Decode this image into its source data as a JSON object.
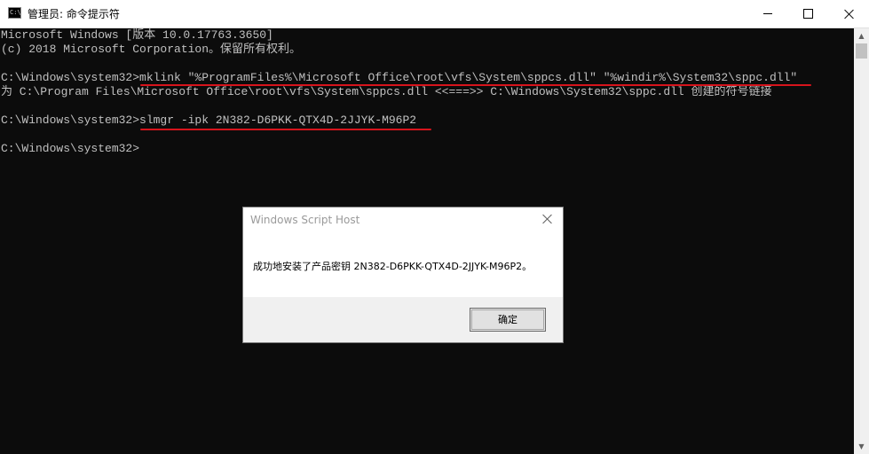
{
  "window": {
    "title": "管理员: 命令提示符",
    "icon_label": "C:\\",
    "icon": "cmd-icon",
    "controls": [
      "minimize-icon",
      "maximize-icon",
      "close-icon"
    ]
  },
  "console": {
    "lines": [
      "Microsoft Windows [版本 10.0.17763.3650]",
      "(c) 2018 Microsoft Corporation。保留所有权利。",
      "",
      "C:\\Windows\\system32>mklink \"%ProgramFiles%\\Microsoft Office\\root\\vfs\\System\\sppcs.dll\" \"%windir%\\System32\\sppc.dll\"",
      "为 C:\\Program Files\\Microsoft Office\\root\\vfs\\System\\sppcs.dll <<===>> C:\\Windows\\System32\\sppc.dll 创建的符号链接",
      "",
      "C:\\Windows\\system32>slmgr -ipk 2N382-D6PKK-QTX4D-2JJYK-M96P2",
      "",
      "C:\\Windows\\system32>"
    ],
    "annotation_color": "#d7141c"
  },
  "dialog": {
    "title": "Windows Script Host",
    "message": "成功地安装了产品密钥 2N382-D6PKK-QTX4D-2JJYK-M96P2。",
    "ok_label": "确定"
  }
}
